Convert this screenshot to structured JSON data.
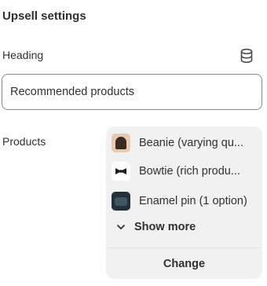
{
  "section": {
    "title": "Upsell settings"
  },
  "heading": {
    "label": "Heading",
    "icon": "database-icon",
    "value": "Recommended products"
  },
  "products": {
    "label": "Products",
    "items": [
      {
        "name": "Beanie (varying qu...",
        "thumb": "beanie-thumbnail"
      },
      {
        "name": "Bowtie (rich produ...",
        "thumb": "bowtie-thumbnail"
      },
      {
        "name": "Enamel pin (1 option)",
        "thumb": "enamel-pin-thumbnail"
      }
    ],
    "show_more_label": "Show more",
    "change_label": "Change"
  }
}
